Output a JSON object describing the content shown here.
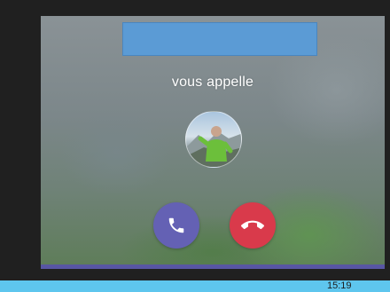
{
  "call": {
    "caller_name": "",
    "incoming_text": "vous appelle",
    "accept_icon": "phone-icon",
    "decline_icon": "hang-up-icon"
  },
  "taskbar": {
    "time": "15:19"
  },
  "colors": {
    "caller_box": "#5b9bd5",
    "accept": "#6461b4",
    "decline": "#d93a4b",
    "bottom_strip": "#5856a3",
    "taskbar": "#5ec6ee"
  }
}
